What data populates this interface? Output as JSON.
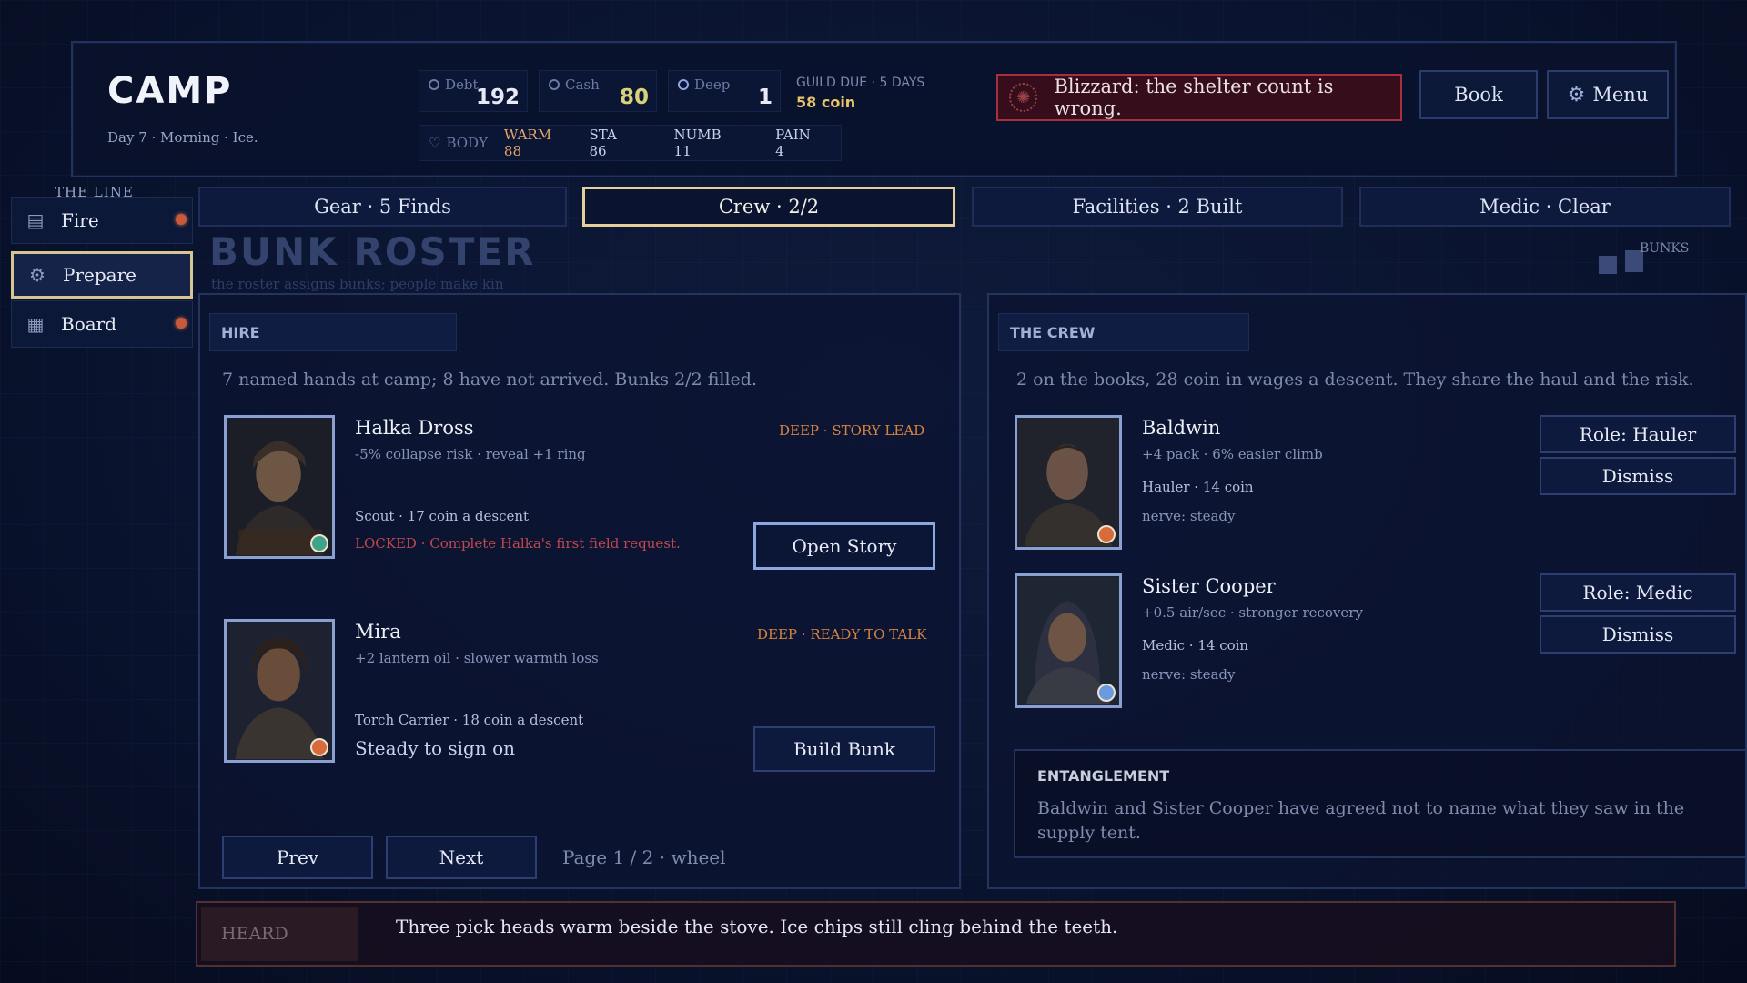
{
  "header": {
    "title": "CAMP",
    "subtitle": "Day 7 · Morning · Ice.",
    "stats": [
      {
        "label": "Debt",
        "value": "192",
        "color": "#e6eaf5"
      },
      {
        "label": "Cash",
        "value": "80",
        "color": "#d8d07a"
      },
      {
        "label": "Deep",
        "value": "1",
        "color": "#e6eaf5"
      }
    ],
    "guild_label": "GUILD DUE · 5 DAYS",
    "guild_value": "58 coin",
    "body": {
      "label": "BODY",
      "warm": "WARM 88",
      "sta": "STA 86",
      "numb": "NUMB 11",
      "pain": "PAIN 4"
    },
    "alert": "Blizzard: the shelter count is wrong.",
    "book_label": "Book",
    "menu_label": "Menu"
  },
  "sidebar": {
    "label": "THE LINE",
    "items": [
      {
        "label": "Fire",
        "icon": "stove-icon",
        "active": false,
        "alert": true
      },
      {
        "label": "Prepare",
        "icon": "gear-icon",
        "active": true,
        "alert": false
      },
      {
        "label": "Board",
        "icon": "grid-icon",
        "active": false,
        "alert": true
      }
    ]
  },
  "tabs": [
    {
      "label": "Gear · 5 Finds",
      "active": false
    },
    {
      "label": "Crew · 2/2",
      "active": true
    },
    {
      "label": "Facilities · 2 Built",
      "active": false
    },
    {
      "label": "Medic · Clear",
      "active": false
    }
  ],
  "section": {
    "title": "BUNK ROSTER",
    "subtitle": "the roster assigns bunks; people make kin",
    "bunks_label": "BUNKS"
  },
  "hire": {
    "title": "HIRE",
    "desc": "7 named hands at camp; 8 have not arrived. Bunks 2/2 filled.",
    "cards": [
      {
        "name": "Halka Dross",
        "perks": "-5% collapse risk · reveal +1 ring",
        "tag": "DEEP · STORY LEAD",
        "role": "Scout · 17 coin a descent",
        "status": "LOCKED · Complete Halka's first field request.",
        "button": "Open Story",
        "badge_color": "#3fa38a"
      },
      {
        "name": "Mira",
        "perks": "+2 lantern oil · slower warmth loss",
        "tag": "DEEP · READY TO TALK",
        "role": "Torch Carrier · 18 coin a descent",
        "status": "Steady to sign on",
        "button": "Build Bunk",
        "badge_color": "#d96a3a"
      }
    ],
    "prev": "Prev",
    "next": "Next",
    "page_info": "Page 1 / 2 · wheel"
  },
  "crew": {
    "title": "THE CREW",
    "desc": "2 on the books, 28 coin in wages a descent. They share the haul and the risk.",
    "members": [
      {
        "name": "Baldwin",
        "perks": "+4 pack · 6% easier climb",
        "role": "Hauler · 14 coin",
        "nerve": "nerve: steady",
        "role_button": "Role: Hauler",
        "dismiss": "Dismiss",
        "badge_color": "#d96a3a"
      },
      {
        "name": "Sister Cooper",
        "perks": "+0.5 air/sec · stronger recovery",
        "role": "Medic · 14 coin",
        "nerve": "nerve: steady",
        "role_button": "Role: Medic",
        "dismiss": "Dismiss",
        "badge_color": "#6a9ae0"
      }
    ],
    "entanglement_title": "ENTANGLEMENT",
    "entanglement_text": "Baldwin and Sister Cooper have agreed not to name what they saw in the supply tent."
  },
  "footer": {
    "label": "HEARD",
    "message": "Three pick heads warm beside the stove. Ice chips still cling behind the teeth."
  }
}
